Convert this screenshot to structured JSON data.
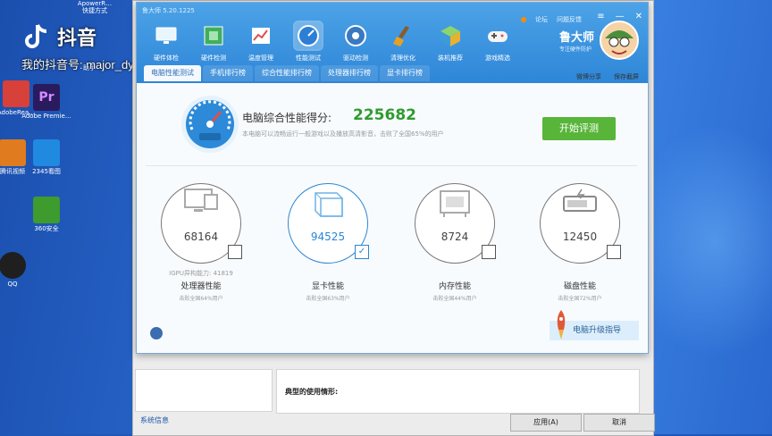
{
  "watermark": {
    "app": "抖音",
    "account": "我的抖音号: major_dyx"
  },
  "desktop_icons": [
    {
      "label": "AdobeRea…",
      "color": "#d8403a"
    },
    {
      "label": "Adobe Premie…",
      "color": "#2a1a5e"
    },
    {
      "label": "2345看图",
      "color": "#1f8ae0"
    },
    {
      "label": "腾讯视频",
      "color": "#e07b1f"
    },
    {
      "label": "360安全",
      "color": "#3e9b2e"
    },
    {
      "label": "QQ",
      "color": "#1f1f1f"
    }
  ],
  "desktop_partial_labels": [
    "ApowerR…",
    "快捷方式",
    "助手"
  ],
  "app": {
    "title": "鲁大师 5.20.1225",
    "top_links": [
      "论坛",
      "问题反馈"
    ],
    "nav": [
      {
        "label": "硬件体检",
        "icon": "monitor-icon",
        "color": "#3aa0e8"
      },
      {
        "label": "硬件检测",
        "icon": "board-icon",
        "color": "#3fb05a"
      },
      {
        "label": "温度管理",
        "icon": "chart-icon",
        "color": "#e04e4e"
      },
      {
        "label": "性能测试",
        "icon": "speedometer-icon",
        "color": "#2c7fd4"
      },
      {
        "label": "驱动检测",
        "icon": "gear-icon",
        "color": "#3a78c2"
      },
      {
        "label": "清理优化",
        "icon": "broom-icon",
        "color": "#e6a21f"
      },
      {
        "label": "装机推荐",
        "icon": "cube-icon",
        "color": "#6fc04c"
      },
      {
        "label": "游戏精选",
        "icon": "gamepad-icon",
        "color": "#f0f0f0"
      }
    ],
    "active_nav_index": 3,
    "brand": {
      "name": "鲁大师",
      "slogan": "专注硬件防护"
    },
    "tabs": [
      "电脑性能测试",
      "手机排行榜",
      "综合性能排行榜",
      "处理器排行榜",
      "显卡排行榜"
    ],
    "active_tab_index": 0,
    "tab_right": [
      "微博分享",
      "保存截屏"
    ],
    "score_label": "电脑综合性能得分:",
    "score_value": "225682",
    "score_desc": "本电脑可以流畅运行一般游戏以及播放高清影音，击败了全国65%的用户",
    "start_button": "开始评测",
    "components": [
      {
        "name": "处理器性能",
        "score": "68164",
        "extra": "IGPU异构能力: 41819",
        "sub": "击败全国64%用户",
        "checked": false
      },
      {
        "name": "显卡性能",
        "score": "94525",
        "extra": "",
        "sub": "击败全国63%用户",
        "checked": true
      },
      {
        "name": "内存性能",
        "score": "8724",
        "extra": "",
        "sub": "击败全国44%用户",
        "checked": false
      },
      {
        "name": "磁盘性能",
        "score": "12450",
        "extra": "",
        "sub": "击败全国72%用户",
        "checked": false
      }
    ],
    "upgrade_guide": "电脑升级指导"
  },
  "background_dialog": {
    "typical_usage_label": "典型的使用情形:",
    "sys_info_link": "系统信息",
    "apply_button": "应用(A)",
    "cancel_button": "取消"
  }
}
